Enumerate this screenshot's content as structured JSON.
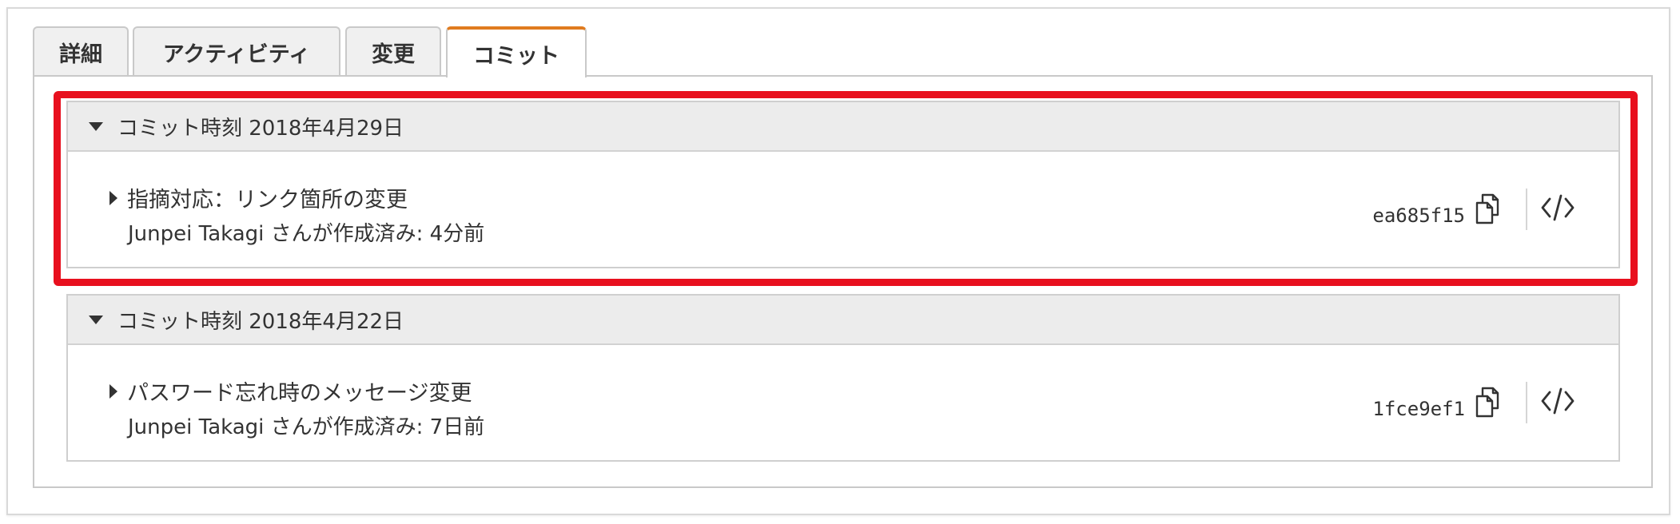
{
  "tabs": [
    {
      "label": "詳細",
      "active": false
    },
    {
      "label": "アクティビティ",
      "active": false
    },
    {
      "label": "変更",
      "active": false
    },
    {
      "label": "コミット",
      "active": true
    }
  ],
  "commit_groups": [
    {
      "header": "コミット時刻 2018年4月29日",
      "highlighted": true,
      "commits": [
        {
          "message": "指摘対応：リンク箇所の変更",
          "author_line": "Junpei Takagi さんが作成済み: 4分前",
          "commit_id": "ea685f15"
        }
      ]
    },
    {
      "header": "コミット時刻 2018年4月22日",
      "highlighted": false,
      "commits": [
        {
          "message": "パスワード忘れ時のメッセージ変更",
          "author_line": "Junpei Takagi さんが作成済み: 7日前",
          "commit_id": "1fce9ef1"
        }
      ]
    }
  ],
  "icons": {
    "expand": "caret-down-icon",
    "commit_expand": "caret-right-icon",
    "copy": "copy-icon",
    "view_code": "code-icon"
  },
  "colors": {
    "active_tab_accent": "#e07b1f",
    "highlight": "#e8101e",
    "group_header_bg": "#ececec"
  }
}
